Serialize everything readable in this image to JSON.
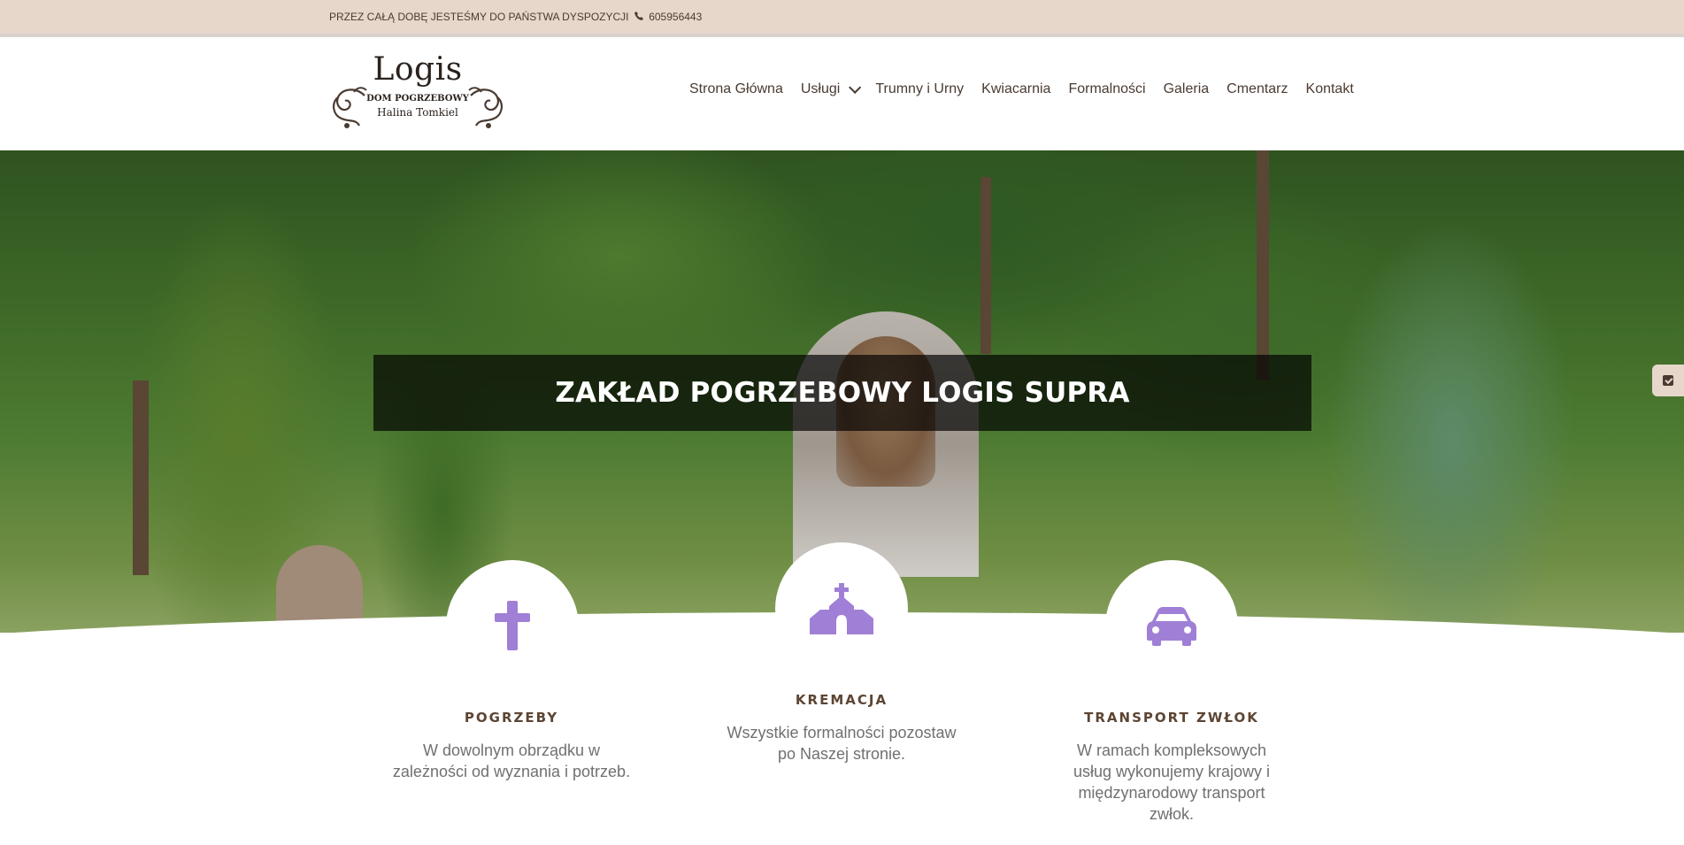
{
  "topbar": {
    "notice": "PRZEZ CAŁĄ DOBĘ JESTEŚMY DO PAŃSTWA DYSPOZYCJI",
    "phone_icon": "phone-icon",
    "phone": "605956443"
  },
  "logo": {
    "title": "Logis",
    "subtitle": "DOM POGRZEBOWY",
    "owner": "Halina Tomkiel"
  },
  "nav": {
    "items": [
      {
        "label": "Strona Główna"
      },
      {
        "label": "Usługi"
      },
      {
        "label": "Trumny i Urny"
      },
      {
        "label": "Kwiacarnia"
      },
      {
        "label": "Formalności"
      },
      {
        "label": "Galeria"
      },
      {
        "label": "Cmentarz"
      },
      {
        "label": "Kontakt"
      }
    ]
  },
  "hero": {
    "title": "ZAKŁAD POGRZEBOWY LOGIS SUPRA"
  },
  "features": [
    {
      "icon": "cross-icon",
      "title": "POGRZEBY",
      "description": "W dowolnym obrządku w zależności od wyznania i potrzeb."
    },
    {
      "icon": "church-icon",
      "title": "KREMACJA",
      "description": "Wszystkie formalności pozostaw po Naszej stronie."
    },
    {
      "icon": "car-icon",
      "title": "TRANSPORT ZWŁOK",
      "description": "W ramach kompleksowych usług wykonujemy krajowy i międzynarodowy transport zwłok."
    }
  ],
  "colors": {
    "topbar_bg": "#e7d7ca",
    "text_brown": "#4a3b32",
    "icon_purple": "#a07fd6"
  }
}
